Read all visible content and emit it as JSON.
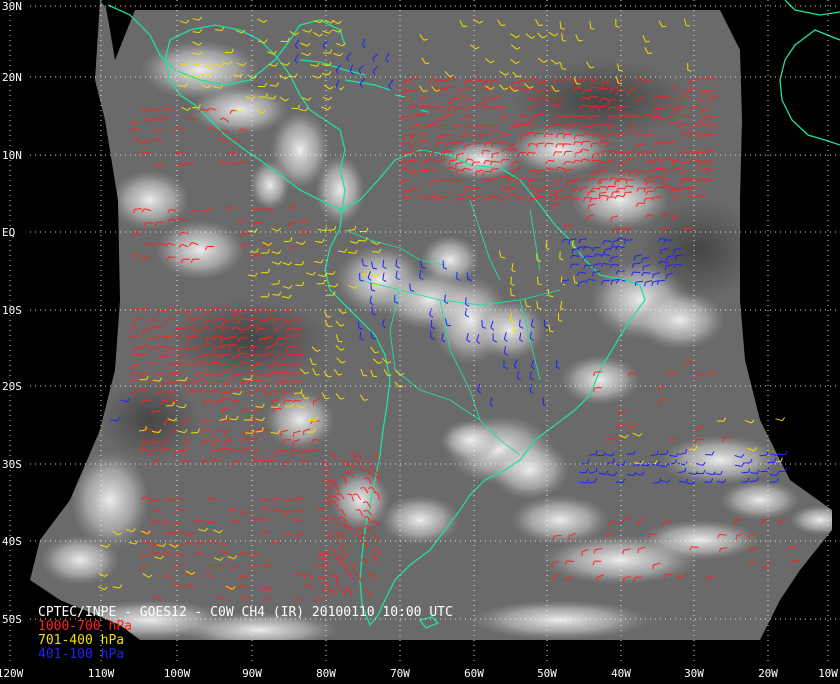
{
  "title": "CPTEC/INPE - GOES12 - C0W CH4 (IR) 20100110 10:00 UTC",
  "lat_labels": [
    "30N",
    "20N",
    "10N",
    "EQ",
    "10S",
    "20S",
    "30S",
    "40S",
    "50S"
  ],
  "lon_labels": [
    "120W",
    "110W",
    "100W",
    "90W",
    "80W",
    "70W",
    "60W",
    "50W",
    "40W",
    "30W",
    "20W",
    "10W"
  ],
  "legend": [
    {
      "label": "1000-700 hPa",
      "color": "#ff2020"
    },
    {
      "label": "701-400 hPa",
      "color": "#f0e000"
    },
    {
      "label": "401-100 hPa",
      "color": "#2020ff"
    }
  ],
  "colors": {
    "background": "#000000",
    "imagery_gray": "#6a6a6a",
    "coastline": "#20e0a0",
    "grid": "#ffffff"
  }
}
